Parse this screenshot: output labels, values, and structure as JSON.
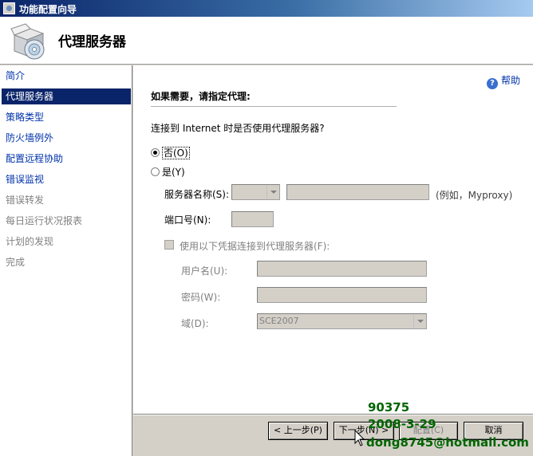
{
  "window": {
    "title": "功能配置向导"
  },
  "header": {
    "title": "代理服务器"
  },
  "sidebar": {
    "items": [
      {
        "label": "简介"
      },
      {
        "label": "代理服务器"
      },
      {
        "label": "策略类型"
      },
      {
        "label": "防火墙例外"
      },
      {
        "label": "配置远程协助"
      },
      {
        "label": "错误监视"
      },
      {
        "label": "错误转发"
      },
      {
        "label": "每日运行状况报表"
      },
      {
        "label": "计划的发现"
      },
      {
        "label": "完成"
      }
    ]
  },
  "main": {
    "help_label": "帮助",
    "section_title": "如果需要，请指定代理:",
    "question": "连接到 Internet 时是否使用代理服务器?",
    "radio_no": "否(O)",
    "radio_yes": "是(Y)",
    "server_name_label": "服务器名称(S):",
    "server_hint": "(例如，Myproxy)",
    "port_label": "端口号(N):",
    "use_credentials_label": "使用以下凭据连接到代理服务器(F):",
    "username_label": "用户名(U):",
    "password_label": "密码(W):",
    "domain_label": "域(D):",
    "domain_value": "SCE2007"
  },
  "buttons": {
    "back": "< 上一步(P)",
    "next": "下一步(N) >",
    "configure": "配置(C)",
    "cancel": "取消"
  },
  "watermark": {
    "line1": "90375",
    "line2": "2008-3-29",
    "line3": "dong8745@hotmail.com"
  }
}
